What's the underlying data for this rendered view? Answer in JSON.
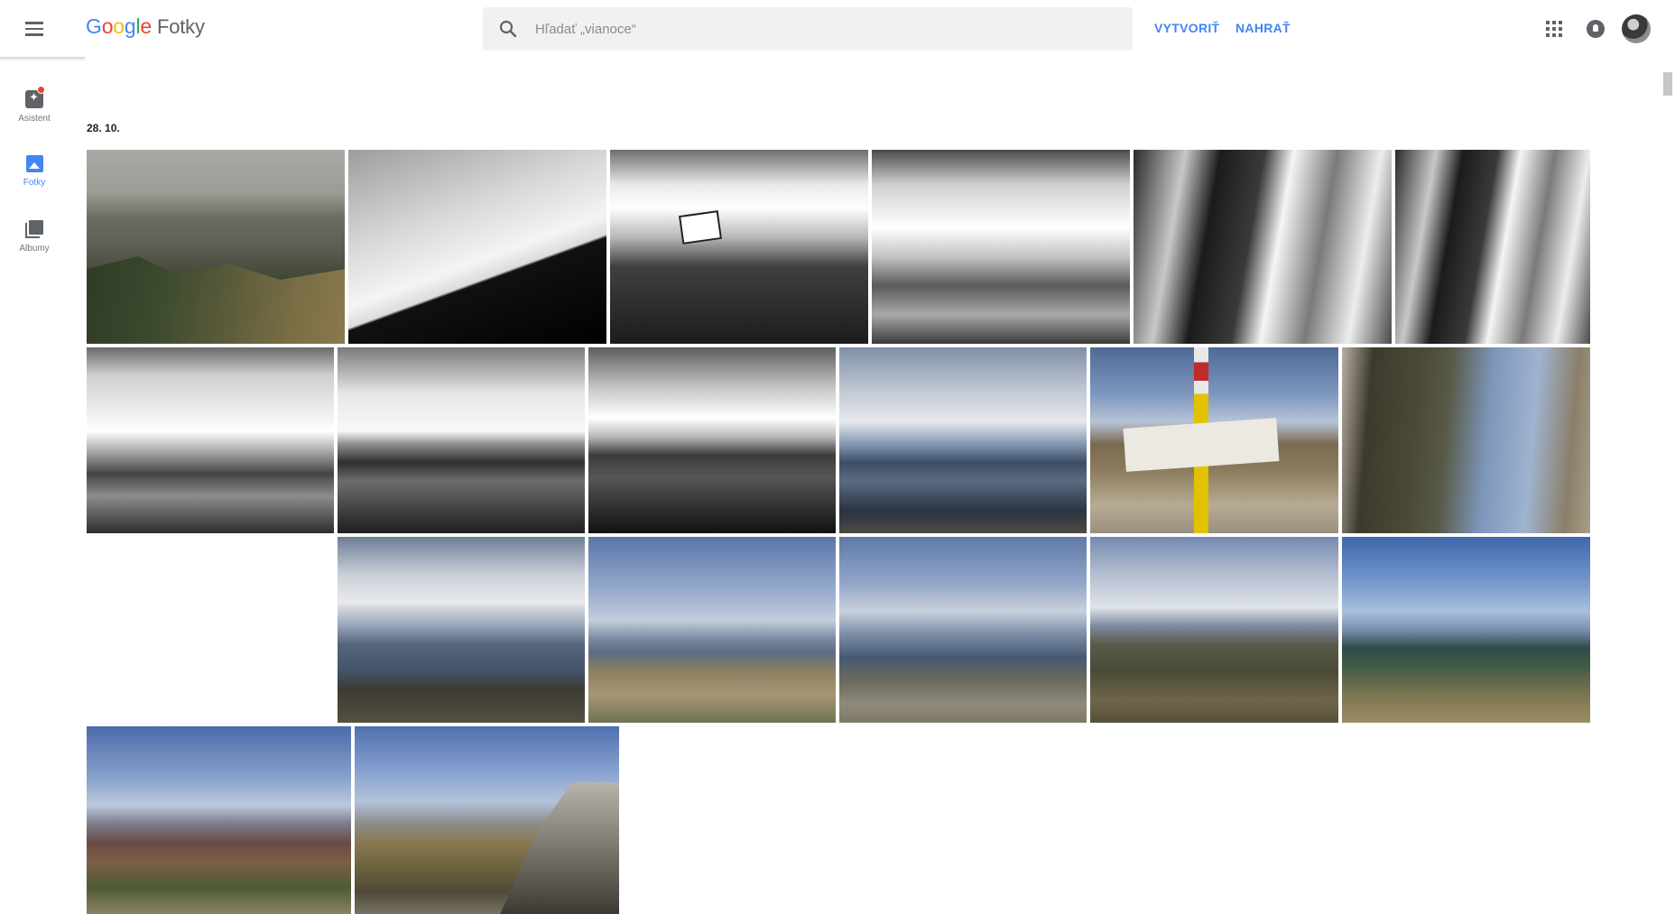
{
  "app": {
    "logo_letters": [
      "G",
      "o",
      "o",
      "g",
      "l",
      "e"
    ],
    "product_name": "Fotky"
  },
  "search": {
    "placeholder": "Hľadať „vianoce“",
    "value": ""
  },
  "header_actions": {
    "create_label": "VYTVORIŤ",
    "upload_label": "NAHRAŤ"
  },
  "icons": {
    "menu": "menu-icon",
    "search": "search-icon",
    "apps": "apps-grid-icon",
    "notifications": "notifications-icon",
    "avatar": "account-avatar"
  },
  "sidebar": {
    "items": [
      {
        "label": "Asistent",
        "icon": "assistant-icon",
        "has_badge": true,
        "active": false
      },
      {
        "label": "Fotky",
        "icon": "photos-icon",
        "active": true
      },
      {
        "label": "Albumy",
        "icon": "albums-icon",
        "active": false
      }
    ]
  },
  "gallery": {
    "date_label": "28. 10.",
    "photo_count": 20
  },
  "colors": {
    "accent": "#4285f4",
    "badge": "#ea4335",
    "icon_gray": "#5f6368",
    "search_bg": "#f1f1f1"
  }
}
